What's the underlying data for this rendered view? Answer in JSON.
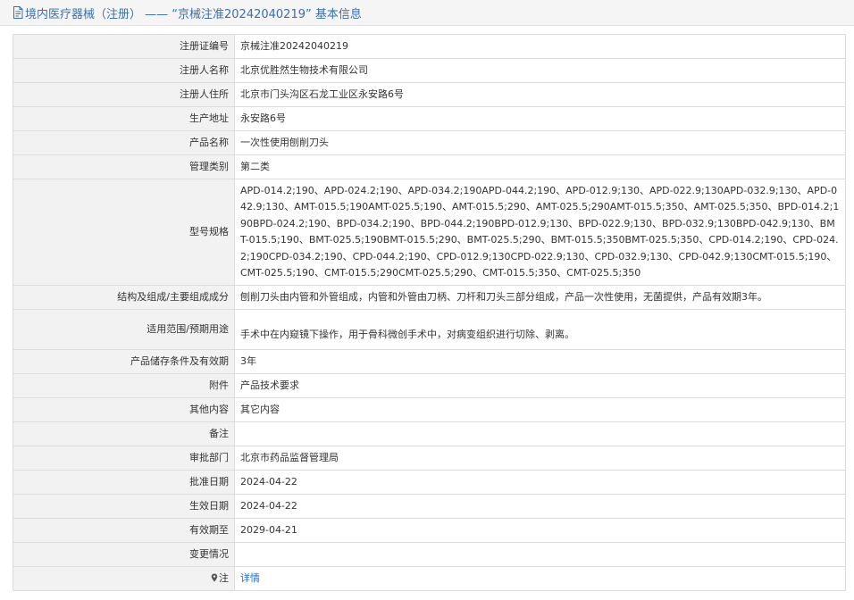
{
  "header": {
    "title": "境内医疗器械（注册） —— “京械注准20242040219” 基本信息",
    "icon": "document-icon"
  },
  "rows": [
    {
      "label": "注册证编号",
      "value": "京械注准20242040219"
    },
    {
      "label": "注册人名称",
      "value": "北京优胜然生物技术有限公司"
    },
    {
      "label": "注册人住所",
      "value": "北京市门头沟区石龙工业区永安路6号"
    },
    {
      "label": "生产地址",
      "value": "永安路6号"
    },
    {
      "label": "产品名称",
      "value": "一次性使用刨削刀头"
    },
    {
      "label": "管理类别",
      "value": "第二类"
    },
    {
      "label": "型号规格",
      "value": "APD-014.2;190、APD-024.2;190、APD-034.2;190APD-044.2;190、APD-012.9;130、APD-022.9;130APD-032.9;130、APD-042.9;130、AMT-015.5;190AMT-025.5;190、AMT-015.5;290、AMT-025.5;290AMT-015.5;350、AMT-025.5;350、BPD-014.2;190BPD-024.2;190、BPD-034.2;190、BPD-044.2;190BPD-012.9;130、BPD-022.9;130、BPD-032.9;130BPD-042.9;130、BMT-015.5;190、BMT-025.5;190BMT-015.5;290、BMT-025.5;290、BMT-015.5;350BMT-025.5;350、CPD-014.2;190、CPD-024.2;190CPD-034.2;190、CPD-044.2;190、CPD-012.9;130CPD-022.9;130、CPD-032.9;130、CPD-042.9;130CMT-015.5;190、CMT-025.5;190、CMT-015.5;290CMT-025.5;290、CMT-015.5;350、CMT-025.5;350"
    },
    {
      "label": "结构及组成/主要组成成分",
      "value": "刨削刀头由内管和外管组成，内管和外管由刀柄、刀杆和刀头三部分组成，产品一次性使用，无菌提供，产品有效期3年。"
    },
    {
      "label": "适用范围/预期用途",
      "value": "手术中在内窥镜下操作，用于骨科微创手术中，对病变组织进行切除、剥离。"
    },
    {
      "label": "产品储存条件及有效期",
      "value": "3年"
    },
    {
      "label": "附件",
      "value": "产品技术要求"
    },
    {
      "label": "其他内容",
      "value": "其它内容"
    },
    {
      "label": "备注",
      "value": ""
    },
    {
      "label": "审批部门",
      "value": "北京市药品监督管理局"
    },
    {
      "label": "批准日期",
      "value": "2024-04-22"
    },
    {
      "label": "生效日期",
      "value": "2024-04-22"
    },
    {
      "label": "有效期至",
      "value": "2029-04-21"
    },
    {
      "label": "变更情况",
      "value": ""
    },
    {
      "label": "注",
      "value": "详情",
      "icon": "map-pin-icon"
    }
  ],
  "colors": {
    "title": "#3a6fb0",
    "link": "#2a6ec8",
    "label_bg": "#f2f2f2",
    "border": "#dcdcdc"
  }
}
